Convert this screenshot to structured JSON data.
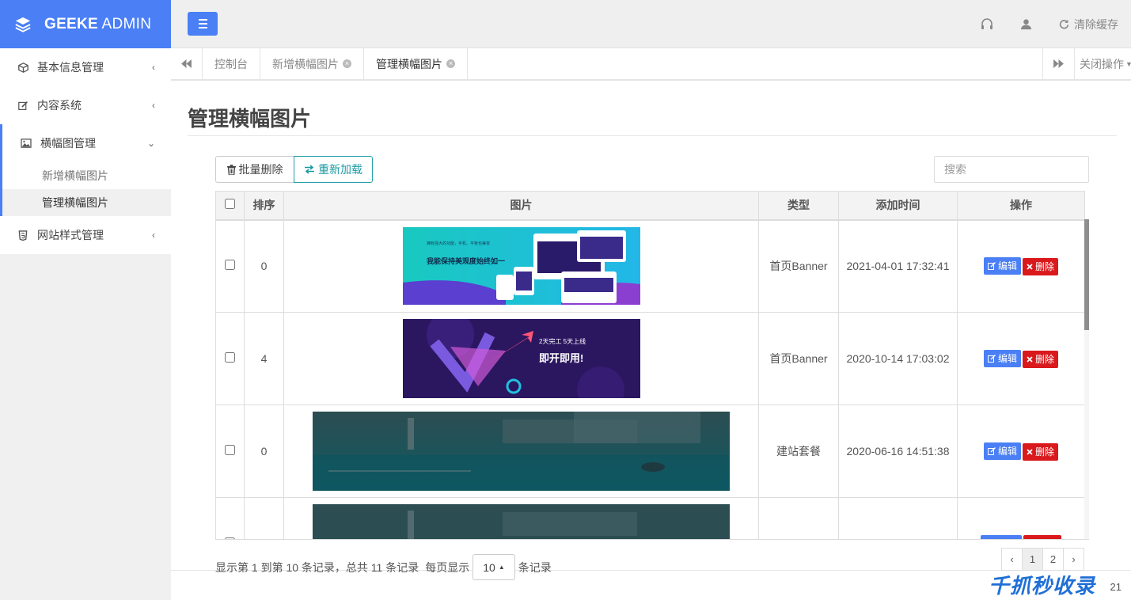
{
  "brand": {
    "name_bold": "GEEKE",
    "name_rest": " ADMIN"
  },
  "sidebar": {
    "items": [
      {
        "label": "基本信息管理",
        "icon": "cube-icon"
      },
      {
        "label": "内容系统",
        "icon": "edit-icon"
      },
      {
        "label": "横幅图管理",
        "icon": "image-icon",
        "open": true,
        "children": [
          {
            "label": "新增横幅图片"
          },
          {
            "label": "管理横幅图片",
            "active": true
          }
        ]
      },
      {
        "label": "网站样式管理",
        "icon": "html5-icon"
      }
    ]
  },
  "topbar": {
    "clear_cache": "清除缓存"
  },
  "tabs": {
    "items": [
      {
        "label": "控制台"
      },
      {
        "label": "新增横幅图片"
      },
      {
        "label": "管理横幅图片"
      }
    ],
    "close_ops": "关闭操作"
  },
  "page": {
    "title": "管理横幅图片"
  },
  "toolbar": {
    "batch_delete": "批量删除",
    "reload": "重新加载",
    "search_placeholder": "搜索"
  },
  "table": {
    "headers": {
      "order": "排序",
      "image": "图片",
      "type": "类型",
      "time": "添加时间",
      "ops": "操作"
    },
    "rows": [
      {
        "order": "0",
        "type": "首页Banner",
        "time": "2021-04-01 17:32:41"
      },
      {
        "order": "4",
        "type": "首页Banner",
        "time": "2020-10-14 17:03:02"
      },
      {
        "order": "0",
        "type": "建站套餐",
        "time": "2020-06-16 14:51:38"
      },
      {
        "order": "",
        "type": "",
        "time": ""
      }
    ],
    "edit_label": "编辑",
    "delete_label": "删除",
    "banner1": {
      "line1": "拥有强大的功能，手机、平板也兼容",
      "line2": "我能保持美观度始终如一",
      "line3": ""
    },
    "banner2": {
      "line1": "2天完工 5天上线",
      "line2": "即开即用!",
      "line3": ""
    }
  },
  "footer": {
    "info_prefix": "显示第 1 到第 10 条记录，总共 11 条记录",
    "per_page": "每页显示",
    "page_size": "10",
    "records": "条记录",
    "pages": [
      "‹",
      "1",
      "2",
      "›"
    ],
    "year": "21"
  },
  "watermark": "千抓秒收录",
  "colors": {
    "primary": "#4a7ff5",
    "danger": "#d9191c",
    "teal": "#26a0a8"
  }
}
